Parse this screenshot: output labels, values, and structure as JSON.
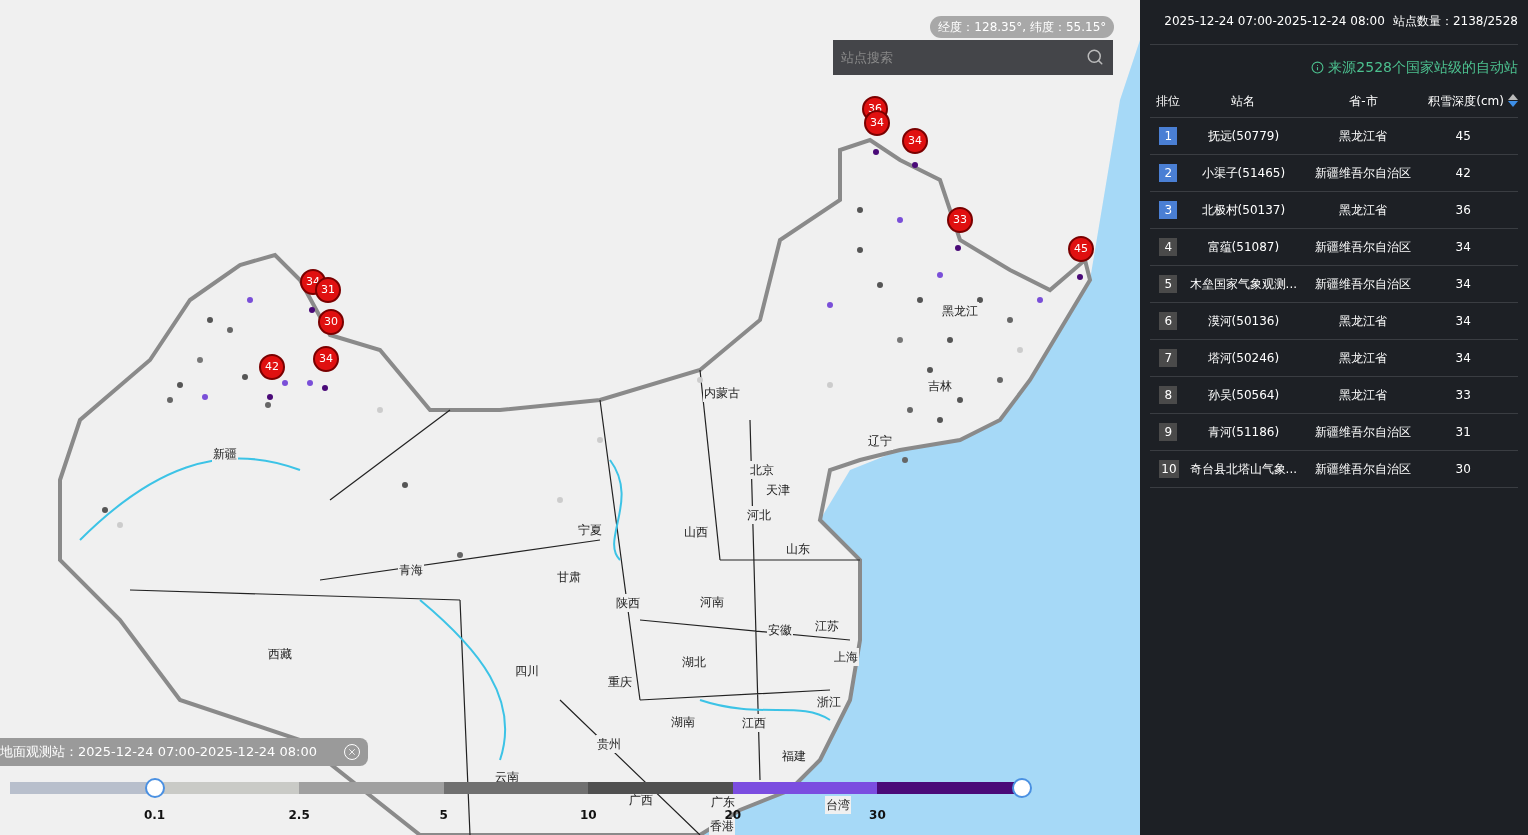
{
  "map": {
    "coordinates": "经度：128.35°, 纬度：55.15°",
    "search": {
      "placeholder": "站点搜索"
    },
    "regions": [
      {
        "name": "新疆"
      },
      {
        "name": "西藏"
      },
      {
        "name": "青海"
      },
      {
        "name": "甘肃"
      },
      {
        "name": "宁夏"
      },
      {
        "name": "内蒙古"
      },
      {
        "name": "黑龙江"
      },
      {
        "name": "吉林"
      },
      {
        "name": "辽宁"
      },
      {
        "name": "北京"
      },
      {
        "name": "天津"
      },
      {
        "name": "河北"
      },
      {
        "name": "山西"
      },
      {
        "name": "山东"
      },
      {
        "name": "陕西"
      },
      {
        "name": "河南"
      },
      {
        "name": "安徽"
      },
      {
        "name": "江苏"
      },
      {
        "name": "上海"
      },
      {
        "name": "四川"
      },
      {
        "name": "湖北"
      },
      {
        "name": "重庆"
      },
      {
        "name": "浙江"
      },
      {
        "name": "湖南"
      },
      {
        "name": "江西"
      },
      {
        "name": "贵州"
      },
      {
        "name": "福建"
      },
      {
        "name": "云南"
      },
      {
        "name": "广西"
      },
      {
        "name": "广东"
      },
      {
        "name": "台湾"
      },
      {
        "name": "香港"
      }
    ],
    "markers": [
      {
        "value": "36"
      },
      {
        "value": "34"
      },
      {
        "value": "34"
      },
      {
        "value": "33"
      },
      {
        "value": "45"
      },
      {
        "value": "34"
      },
      {
        "value": "31"
      },
      {
        "value": "30"
      },
      {
        "value": "34"
      },
      {
        "value": "42"
      }
    ],
    "legend": {
      "title": "地面观测站：2025-12-24 07:00-2025-12-24 08:00",
      "segments": [
        {
          "color": "#c9cac6"
        },
        {
          "color": "#a0a0a0"
        },
        {
          "color": "#707070"
        },
        {
          "color": "#505050"
        },
        {
          "color": "#7b4de0"
        },
        {
          "color": "#4a0a78"
        }
      ],
      "ticks": [
        "0.1",
        "2.5",
        "5",
        "10",
        "20",
        "30"
      ],
      "range": {
        "low": {
          "level": 0.143
        },
        "high": {
          "level": 1
        }
      }
    }
  },
  "panel": {
    "period": "2025-12-24 07:00-2025-12-24 08:00",
    "station_count": "站点数量：2138/2528",
    "source_note": "来源2528个国家站级的自动站",
    "columns": [
      {
        "label": "排位"
      },
      {
        "label": "站名"
      },
      {
        "label": "省-市"
      },
      {
        "label": "积雪深度(cm)",
        "sorted_descending": true
      }
    ],
    "rows": [
      {
        "rank": "1",
        "highlighted": true,
        "name": "抚远(50779)",
        "province": "黑龙江省",
        "depth": "45"
      },
      {
        "rank": "2",
        "highlighted": true,
        "name": "小渠子(51465)",
        "province": "新疆维吾尔自治区",
        "depth": "42"
      },
      {
        "rank": "3",
        "highlighted": true,
        "name": "北极村(50137)",
        "province": "黑龙江省",
        "depth": "36"
      },
      {
        "rank": "4",
        "highlighted": false,
        "name": "富蕴(51087)",
        "province": "新疆维吾尔自治区",
        "depth": "34"
      },
      {
        "rank": "5",
        "highlighted": false,
        "name": "木垒国家气象观测...",
        "province": "新疆维吾尔自治区",
        "depth": "34"
      },
      {
        "rank": "6",
        "highlighted": false,
        "name": "漠河(50136)",
        "province": "黑龙江省",
        "depth": "34"
      },
      {
        "rank": "7",
        "highlighted": false,
        "name": "塔河(50246)",
        "province": "黑龙江省",
        "depth": "34"
      },
      {
        "rank": "8",
        "highlighted": false,
        "name": "孙吴(50564)",
        "province": "黑龙江省",
        "depth": "33"
      },
      {
        "rank": "9",
        "highlighted": false,
        "name": "青河(51186)",
        "province": "新疆维吾尔自治区",
        "depth": "31"
      },
      {
        "rank": "10",
        "highlighted": false,
        "name": "奇台县北塔山气象...",
        "province": "新疆维吾尔自治区",
        "depth": "30"
      }
    ]
  }
}
